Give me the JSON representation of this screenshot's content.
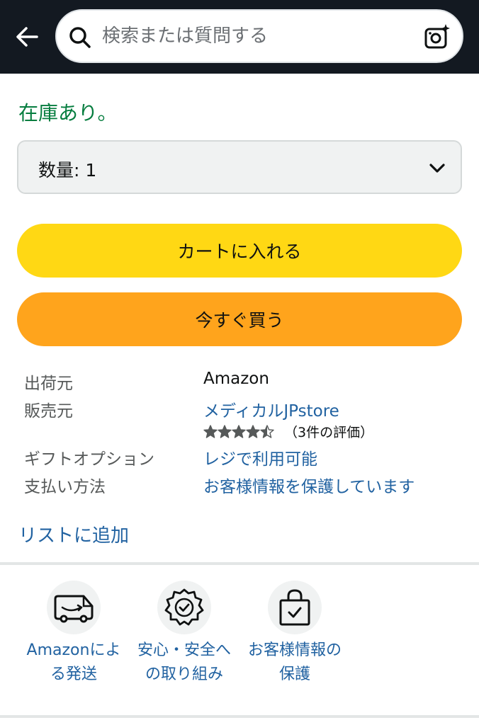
{
  "search": {
    "placeholder": "検索または質問する"
  },
  "stock_status": "在庫あり。",
  "quantity": {
    "label": "数量: 1"
  },
  "buttons": {
    "add_to_cart": "カートに入れる",
    "buy_now": "今すぐ買う"
  },
  "details": {
    "ships_from_label": "出荷元",
    "ships_from_value": "Amazon",
    "sold_by_label": "販売元",
    "sold_by_value": "メディカルJPstore",
    "seller_rating": 4.5,
    "seller_rating_count": "（3件の評価）",
    "gift_label": "ギフトオプション",
    "gift_value": "レジで利用可能",
    "payment_label": "支払い方法",
    "payment_value": "お客様情報を保護しています"
  },
  "add_to_list": "リストに追加",
  "features": [
    {
      "icon": "delivery-van-icon",
      "line1": "Amazonによ",
      "line2": "る発送"
    },
    {
      "icon": "safety-badge-icon",
      "line1": "安心・安全へ",
      "line2": "の取り組み"
    },
    {
      "icon": "secure-bag-icon",
      "line1": "お客様情報の",
      "line2": "保護"
    }
  ],
  "colors": {
    "header_bg": "#131921",
    "in_stock": "#067d3f",
    "link": "#2162a1",
    "cart_button": "#ffd814",
    "buy_button": "#ffa41c"
  }
}
